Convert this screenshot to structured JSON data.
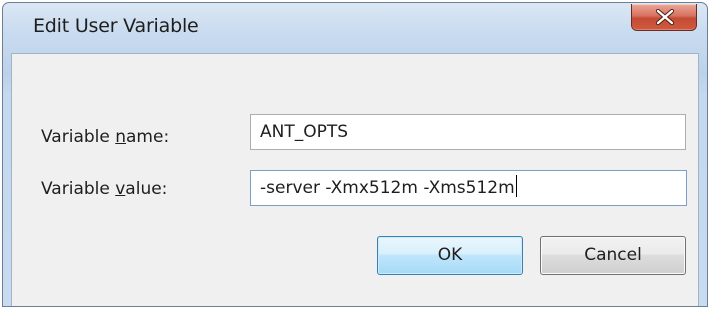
{
  "dialog": {
    "title": "Edit User Variable",
    "close_icon": "close-icon"
  },
  "form": {
    "name_label_prefix": "Variable ",
    "name_label_mnemonic": "n",
    "name_label_suffix": "ame:",
    "name_value": "ANT_OPTS",
    "value_label_prefix": "Variable ",
    "value_label_mnemonic": "v",
    "value_label_suffix": "alue:",
    "value_value": "-server -Xmx512m -Xms512m"
  },
  "buttons": {
    "ok_label": "OK",
    "cancel_label": "Cancel"
  },
  "colors": {
    "titlebar": "#c9dbef",
    "close_button": "#c44b34",
    "client_bg": "#f0f0f0",
    "ok_border": "#3c7fb1"
  }
}
